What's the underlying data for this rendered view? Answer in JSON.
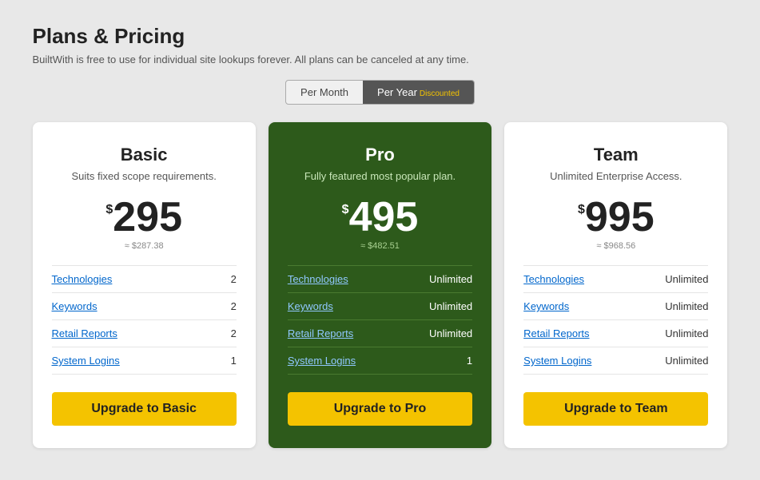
{
  "header": {
    "title": "Plans & Pricing",
    "subtitle": "BuiltWith is free to use for individual site lookups forever. All plans can be canceled at any time."
  },
  "billing": {
    "per_month_label": "Per Month",
    "per_year_label": "Per Year",
    "discounted_label": "Discounted",
    "active": "per_year"
  },
  "plans": [
    {
      "id": "basic",
      "name": "Basic",
      "description": "Suits fixed scope requirements.",
      "price_dollar": "$",
      "price": "295",
      "price_equivalent": "≈ $287.38",
      "featured": false,
      "features": [
        {
          "name": "Technologies",
          "value": "2"
        },
        {
          "name": "Keywords",
          "value": "2"
        },
        {
          "name": "Retail Reports",
          "value": "2"
        },
        {
          "name": "System Logins",
          "value": "1"
        }
      ],
      "button_label": "Upgrade to Basic"
    },
    {
      "id": "pro",
      "name": "Pro",
      "description": "Fully featured most popular plan.",
      "price_dollar": "$",
      "price": "495",
      "price_equivalent": "≈ $482.51",
      "featured": true,
      "features": [
        {
          "name": "Technologies",
          "value": "Unlimited"
        },
        {
          "name": "Keywords",
          "value": "Unlimited"
        },
        {
          "name": "Retail Reports",
          "value": "Unlimited"
        },
        {
          "name": "System Logins",
          "value": "1"
        }
      ],
      "button_label": "Upgrade to Pro"
    },
    {
      "id": "team",
      "name": "Team",
      "description": "Unlimited Enterprise Access.",
      "price_dollar": "$",
      "price": "995",
      "price_equivalent": "≈ $968.56",
      "featured": false,
      "features": [
        {
          "name": "Technologies",
          "value": "Unlimited"
        },
        {
          "name": "Keywords",
          "value": "Unlimited"
        },
        {
          "name": "Retail Reports",
          "value": "Unlimited"
        },
        {
          "name": "System Logins",
          "value": "Unlimited"
        }
      ],
      "button_label": "Upgrade to Team"
    }
  ]
}
